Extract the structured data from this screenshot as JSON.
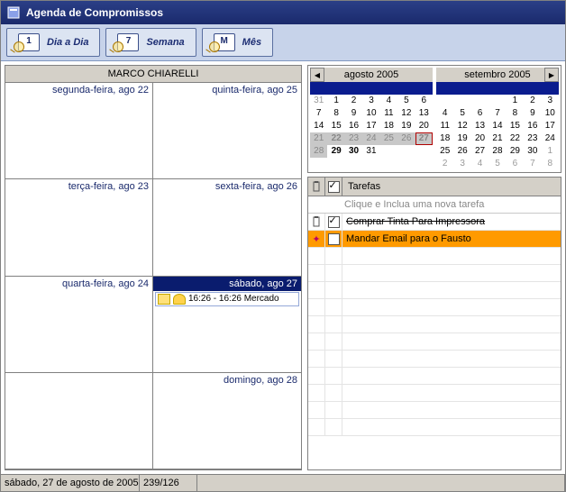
{
  "window": {
    "title": "Agenda de Compromissos"
  },
  "toolbar": {
    "day": {
      "num": "1",
      "label": "Dia a Dia"
    },
    "week": {
      "num": "7",
      "label": "Semana"
    },
    "month": {
      "num": "M",
      "label": "Mês"
    }
  },
  "owner_name": "MARCO CHIARELLI",
  "days": {
    "mon": "segunda-feira, ago 22",
    "tue": "terça-feira, ago 23",
    "wed": "quarta-feira, ago 24",
    "thu": "quinta-feira, ago 25",
    "fri": "sexta-feira, ago 26",
    "sat": "sábado, ago 27",
    "sun": "domingo, ago 28"
  },
  "appointment_sat": "16:26 - 16:26 Mercado",
  "minicals": {
    "left": {
      "title": "agosto 2005"
    },
    "right": {
      "title": "setembro 2005"
    }
  },
  "cal_left": {
    "r0": [
      "31",
      "1",
      "2",
      "3",
      "4",
      "5",
      "6"
    ],
    "r1": [
      "7",
      "8",
      "9",
      "10",
      "11",
      "12",
      "13"
    ],
    "r2": [
      "14",
      "15",
      "16",
      "17",
      "18",
      "19",
      "20"
    ],
    "r3": [
      "21",
      "22",
      "23",
      "24",
      "25",
      "26",
      "27"
    ],
    "r4": [
      "28",
      "29",
      "30",
      "31",
      "",
      "",
      ""
    ]
  },
  "cal_right": {
    "r0": [
      "",
      "",
      "",
      "",
      "1",
      "2",
      "3"
    ],
    "r1": [
      "4",
      "5",
      "6",
      "7",
      "8",
      "9",
      "10"
    ],
    "r2": [
      "11",
      "12",
      "13",
      "14",
      "15",
      "16",
      "17"
    ],
    "r3": [
      "18",
      "19",
      "20",
      "21",
      "22",
      "23",
      "24"
    ],
    "r4": [
      "25",
      "26",
      "27",
      "28",
      "29",
      "30",
      "1"
    ],
    "r5": [
      "2",
      "3",
      "4",
      "5",
      "6",
      "7",
      "8"
    ]
  },
  "tasks": {
    "header": "Tarefas",
    "new_hint": "Clique e Inclua uma nova tarefa",
    "item0": "Comprar Tinta Para Impressora",
    "item1": "Mandar Email para o Fausto"
  },
  "status": {
    "date": "sábado, 27 de agosto de 2005",
    "pos": "239/126"
  }
}
